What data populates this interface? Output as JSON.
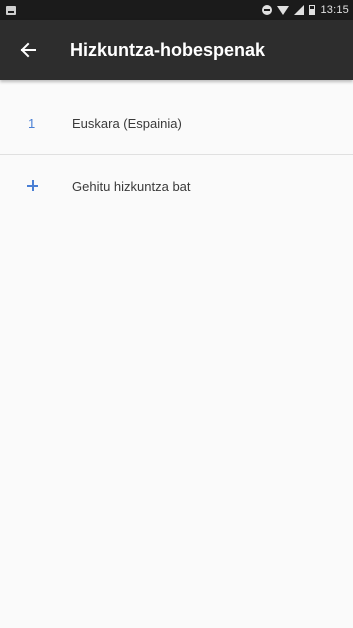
{
  "status_bar": {
    "time": "13:15",
    "icons": [
      "notification-icon",
      "do-not-disturb-icon",
      "wifi-icon",
      "signal-icon",
      "battery-icon"
    ]
  },
  "toolbar": {
    "back_icon": "arrow-left-icon",
    "title": "Hizkuntza-hobespenak"
  },
  "languages": [
    {
      "index": "1",
      "name": "Euskara (Espainia)"
    }
  ],
  "add_language": {
    "icon": "plus-icon",
    "label": "Gehitu hizkuntza bat"
  },
  "colors": {
    "toolbar": "#2d2d2d",
    "status_bar": "#1b1b1b",
    "accent": "#4a7fd4",
    "background": "#fafafa"
  }
}
